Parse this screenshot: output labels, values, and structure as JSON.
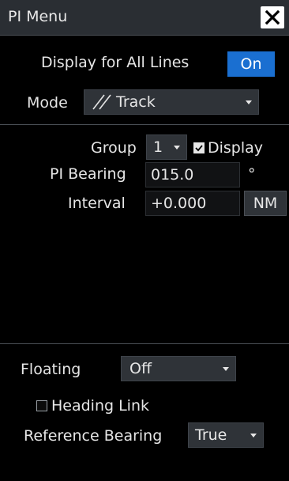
{
  "window": {
    "title": "PI Menu"
  },
  "display_all": {
    "label": "Display for All Lines",
    "button": "On",
    "accent": "#1a6fd1"
  },
  "mode": {
    "label": "Mode",
    "value": "Track",
    "icon": "parallel-lines-icon"
  },
  "group": {
    "label": "Group",
    "value": "1",
    "display_label": "Display",
    "display_checked": true
  },
  "pi_bearing": {
    "label": "PI Bearing",
    "value": "015.0",
    "unit": "°"
  },
  "interval": {
    "label": "Interval",
    "value": "+0.000",
    "unit": "NM"
  },
  "floating": {
    "label": "Floating",
    "value": "Off"
  },
  "heading_link": {
    "label": "Heading Link",
    "checked": false
  },
  "reference_bearing": {
    "label": "Reference Bearing",
    "value": "True"
  }
}
